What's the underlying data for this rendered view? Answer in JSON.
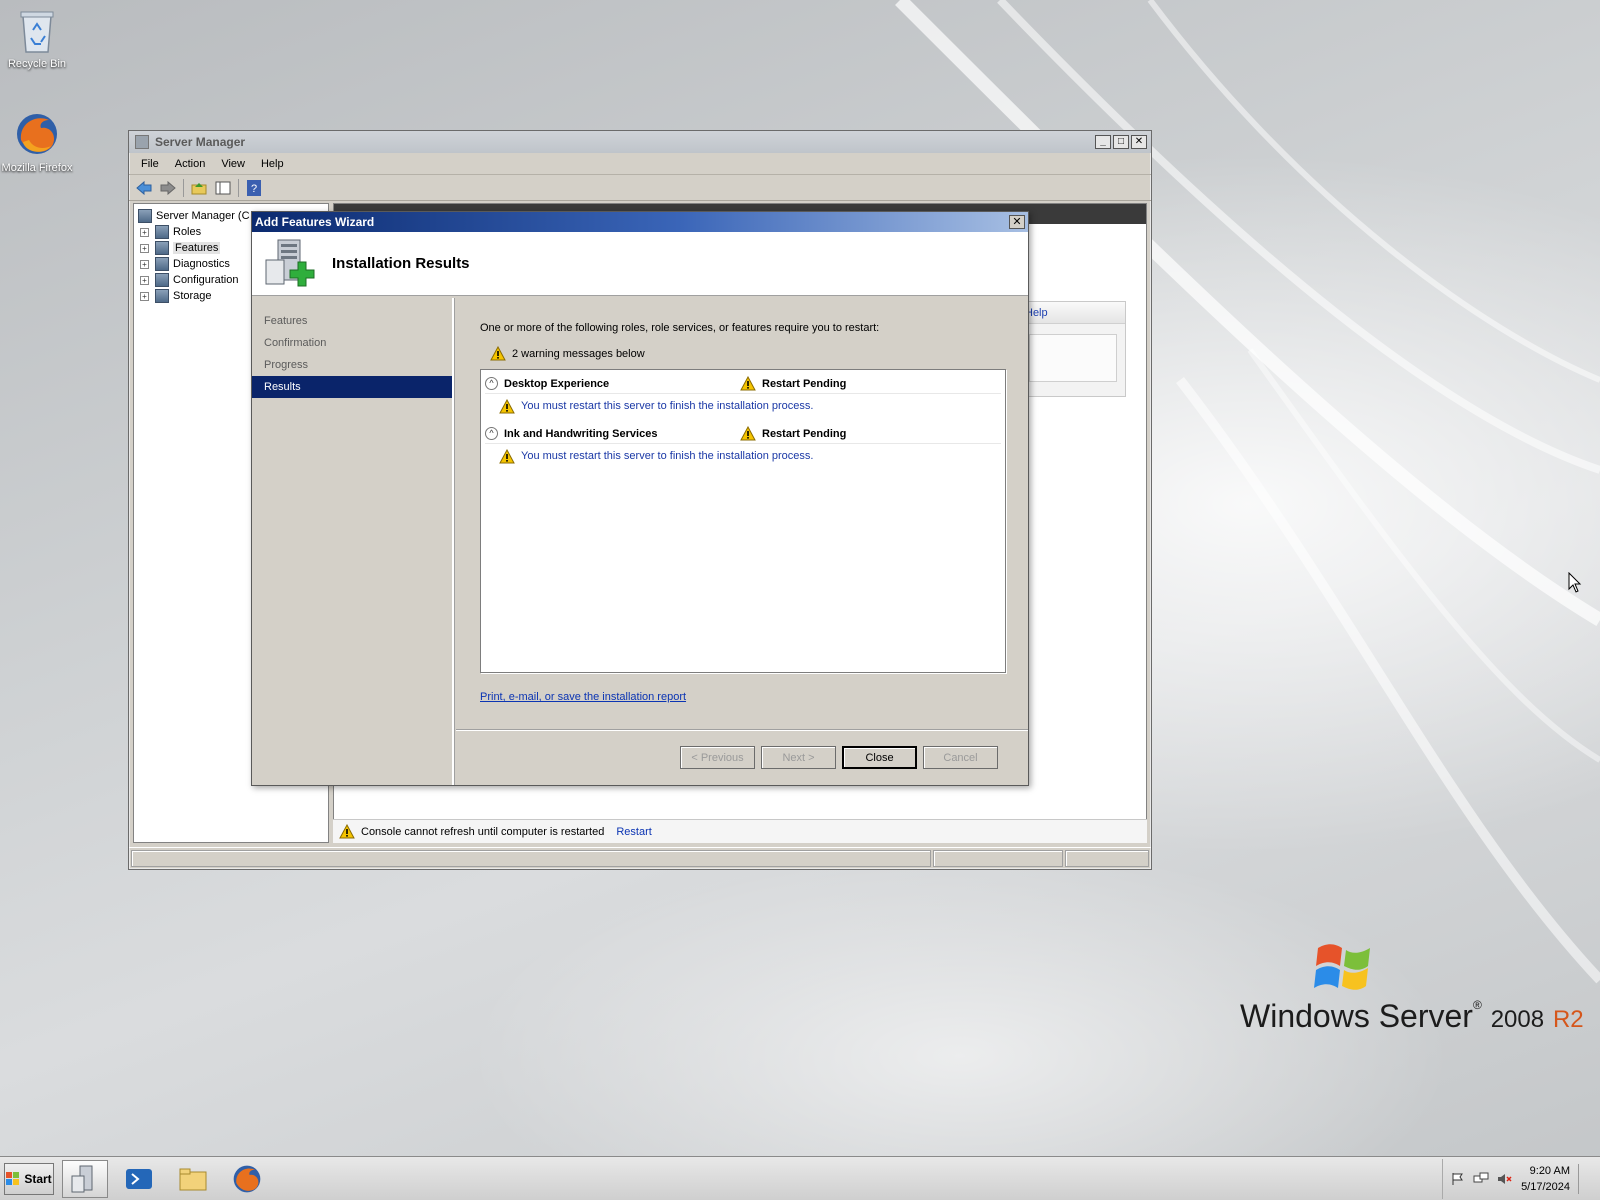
{
  "desktop": {
    "icons": [
      {
        "label": "Recycle Bin",
        "icon": "recycle-bin-icon"
      },
      {
        "label": "Mozilla Firefox",
        "icon": "firefox-icon"
      }
    ],
    "brand": {
      "windows": "Windows Server",
      "version": "2008",
      "edition": "R2"
    }
  },
  "server_manager": {
    "title": "Server Manager",
    "menu": [
      "File",
      "Action",
      "View",
      "Help"
    ],
    "toolbar_icons": [
      "back-icon",
      "forward-icon",
      "up-folder-icon",
      "show-hide-tree-icon",
      "help-icon"
    ],
    "tree": {
      "root": "Server Manager (C",
      "items": [
        "Roles",
        "Features",
        "Diagnostics",
        "Configuration",
        "Storage"
      ],
      "selected": "Features"
    },
    "help_link": "Help",
    "status_message": "Console cannot refresh until computer is restarted",
    "status_link": "Restart"
  },
  "wizard": {
    "title": "Add Features Wizard",
    "header": "Installation Results",
    "steps": [
      "Features",
      "Confirmation",
      "Progress",
      "Results"
    ],
    "active_step": "Results",
    "intro": "One or more of the following roles, role services, or features require you to restart:",
    "warning_count": "2 warning messages below",
    "results": [
      {
        "name": "Desktop Experience",
        "status": "Restart Pending",
        "message": "You must restart this server to finish the installation process."
      },
      {
        "name": "Ink and Handwriting Services",
        "status": "Restart Pending",
        "message": "You must restart this server to finish the installation process."
      }
    ],
    "report_link": "Print, e-mail, or save the installation report",
    "buttons": {
      "previous": "< Previous",
      "next": "Next >",
      "close": "Close",
      "cancel": "Cancel"
    }
  },
  "taskbar": {
    "start": "Start",
    "apps": [
      "server-manager-icon",
      "powershell-icon",
      "explorer-icon",
      "firefox-icon"
    ],
    "tray_icons": [
      "action-center-flag-icon",
      "network-icon",
      "volume-muted-icon"
    ],
    "time": "9:20 AM",
    "date": "5/17/2024"
  },
  "colors": {
    "title_active": "#0a246a",
    "link": "#0b34b3",
    "warning": "#f5c400",
    "r2_accent": "#d5561b"
  }
}
